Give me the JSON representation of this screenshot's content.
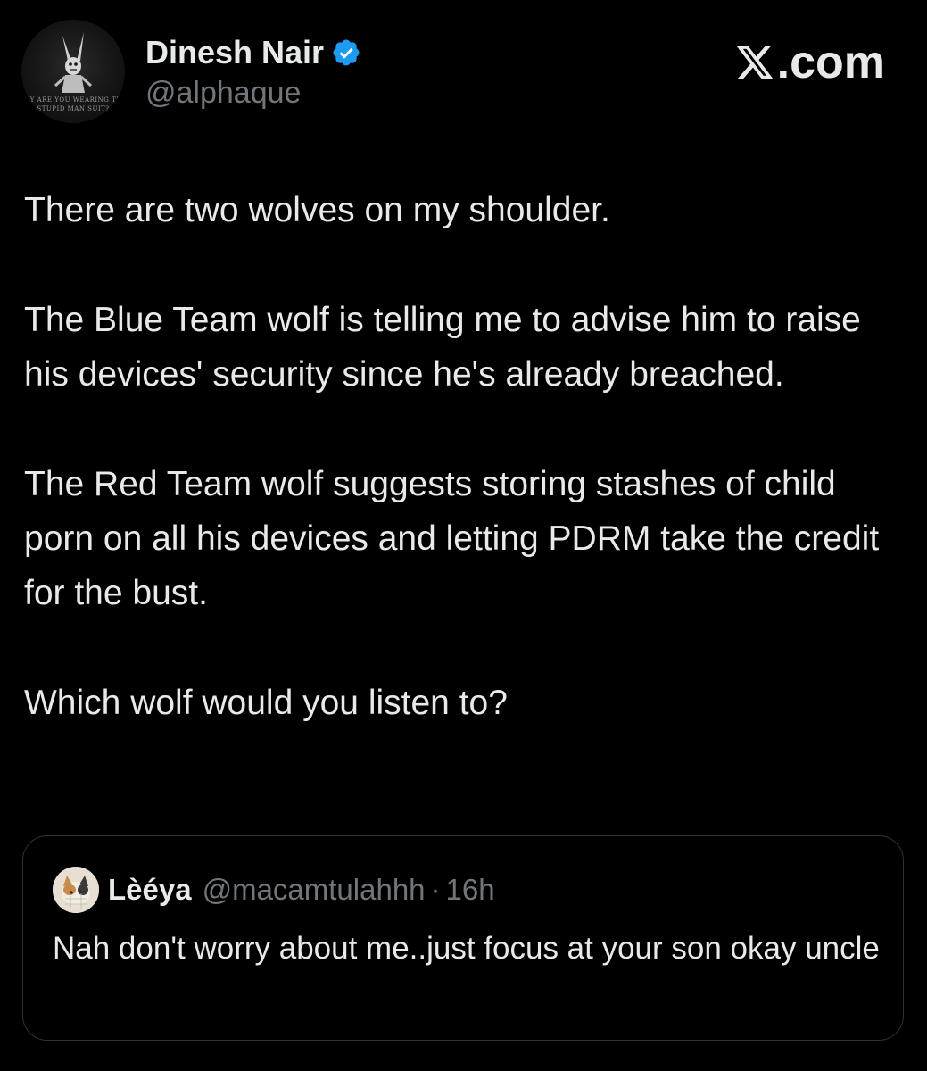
{
  "author": {
    "display_name": "Dinesh Nair",
    "handle": "@alphaque",
    "verified": true,
    "avatar_caption_line1": "HY ARE YOU WEARING TH",
    "avatar_caption_line2": "STUPID MAN SUIT?"
  },
  "brand": {
    "logo_icon": "x-logo-icon",
    "text": ".com"
  },
  "tweet": {
    "paragraphs": [
      "There are two wolves on my shoulder.",
      "The Blue Team wolf is telling me to advise him to raise his devices' security since he's already breached.",
      "The Red Team wolf suggests storing stashes of child porn on all his devices and letting PDRM take the credit for the bust.",
      "Which wolf would you listen to?"
    ]
  },
  "quoted_tweet": {
    "display_name": "Lèéya",
    "handle": "@macamtulahhh",
    "separator": "·",
    "time": "16h",
    "text": "Nah don't worry about me..just focus at your son okay uncle"
  },
  "colors": {
    "background": "#000000",
    "text_primary": "#e7e9ea",
    "text_secondary": "#71767b",
    "verified_blue": "#1d9bf0",
    "border": "#2f3336"
  }
}
